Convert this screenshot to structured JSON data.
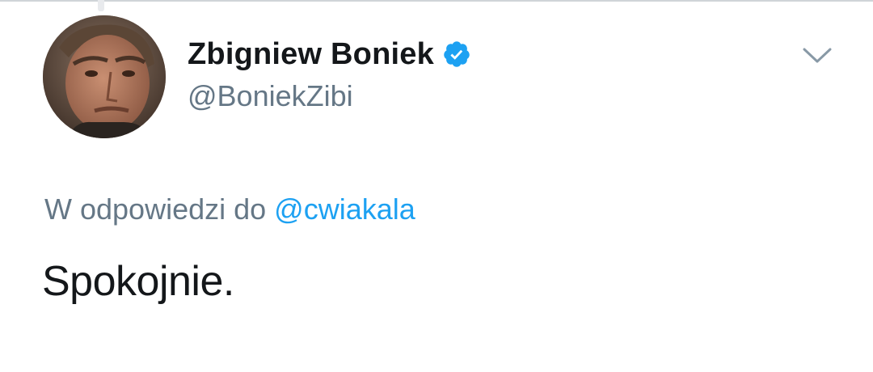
{
  "tweet": {
    "author": {
      "display_name": "Zbigniew Boniek",
      "handle": "@BoniekZibi",
      "verified": true,
      "avatar_icon": "profile-photo"
    },
    "menu_icon": "chevron-down-icon",
    "reply_context": {
      "prefix": "W odpowiedzi do",
      "mention": "@cwiakala"
    },
    "text": "Spokojnie."
  },
  "colors": {
    "text_primary": "#14171a",
    "text_secondary": "#657786",
    "link_blue": "#1da1f2",
    "verified_blue": "#1da1f2"
  }
}
